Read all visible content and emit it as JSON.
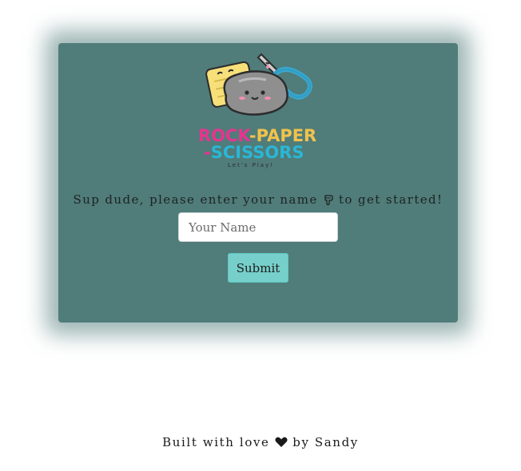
{
  "logo": {
    "word_rock": "ROCK",
    "separator_1": "-",
    "word_paper": "PAPER",
    "separator_2": "-",
    "word_scissors": "SCISSORS",
    "tagline": "Let's Play!",
    "icon": "rock-paper-scissors-mascot-icon"
  },
  "prompt": {
    "before": "Sup dude, please enter your name ",
    "icon": "pointing-down-hand-icon",
    "after": " to get started!"
  },
  "form": {
    "name_placeholder": "Your Name",
    "name_value": "",
    "submit_label": "Submit"
  },
  "footer": {
    "before": "Built with love ",
    "icon": "heart-icon",
    "after": " by Sandy"
  },
  "colors": {
    "card": "#507c7a",
    "button": "#76cfca",
    "logo_pink": "#e6358f",
    "logo_yellow": "#f2c24c",
    "logo_blue": "#2ab7d6"
  }
}
